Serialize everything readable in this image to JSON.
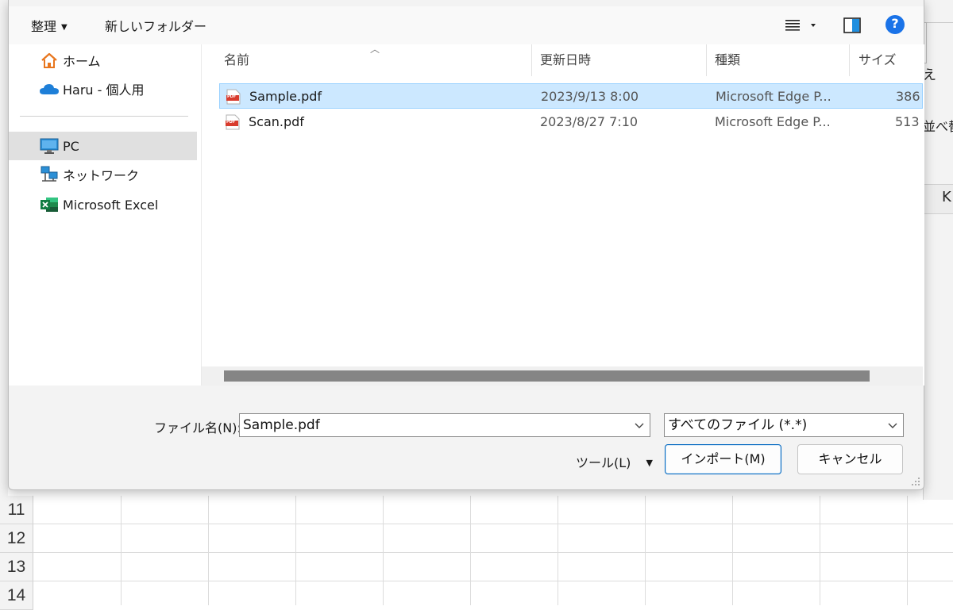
{
  "background": {
    "row_numbers": [
      "11",
      "12",
      "13",
      "14"
    ],
    "right_fragments": [
      "え",
      "並べ替",
      "K"
    ]
  },
  "toolbar": {
    "organize_label": "整理",
    "new_folder_label": "新しいフォルダー",
    "help_label": "?"
  },
  "nav": {
    "items": [
      {
        "label": "ホーム",
        "icon": "home-icon"
      },
      {
        "label": "Haru - 個人用",
        "icon": "onedrive-cloud-icon"
      },
      {
        "label": "PC",
        "icon": "pc-monitor-icon"
      },
      {
        "label": "ネットワーク",
        "icon": "network-icon"
      },
      {
        "label": "Microsoft Excel",
        "icon": "excel-icon"
      }
    ],
    "selected": "PC"
  },
  "files": {
    "columns": [
      "名前",
      "更新日時",
      "種類",
      "サイズ"
    ],
    "rows": [
      {
        "name": "Sample.pdf",
        "modified": "2023/9/13 8:00",
        "type": "Microsoft Edge P...",
        "size": "386",
        "selected": true
      },
      {
        "name": "Scan.pdf",
        "modified": "2023/8/27 7:10",
        "type": "Microsoft Edge P...",
        "size": "513",
        "selected": false
      }
    ],
    "pdf_badge": "PDF"
  },
  "footer": {
    "filename_label": "ファイル名(N):",
    "filename_value": "Sample.pdf",
    "filter_value": "すべてのファイル (*.*)",
    "tools_label": "ツール(L)",
    "import_label": "インポート(M)",
    "cancel_label": "キャンセル"
  },
  "colors": {
    "selection_bg": "#cce8ff",
    "accent": "#0067c0",
    "help_blue": "#1a73e8"
  }
}
